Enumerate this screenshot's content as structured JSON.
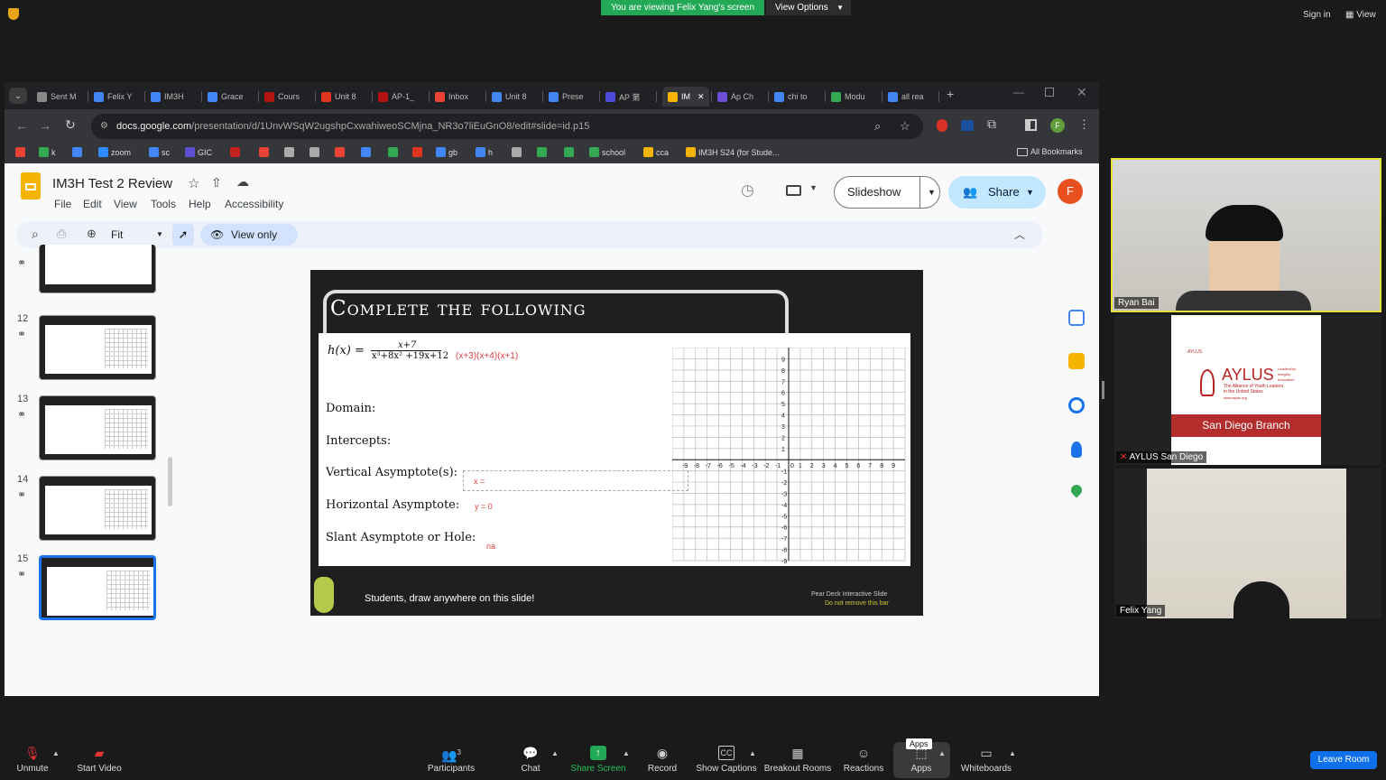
{
  "zoom": {
    "banner": "You are viewing Felix Yang's screen",
    "view_options": "View Options",
    "sign_in": "Sign in",
    "view": "View",
    "toolbar": {
      "unmute": "Unmute",
      "start_video": "Start Video",
      "participants": "Participants",
      "participants_count": "3",
      "chat": "Chat",
      "share_screen": "Share Screen",
      "record": "Record",
      "show_captions": "Show Captions",
      "breakout_rooms": "Breakout Rooms",
      "reactions": "Reactions",
      "apps": "Apps",
      "apps_tooltip": "Apps",
      "whiteboards": "Whiteboards",
      "leave": "Leave Room"
    },
    "participants": [
      {
        "name": "Ryan Bai"
      },
      {
        "name": "AYLUS San Diego"
      },
      {
        "name": "Felix Yang"
      }
    ],
    "aylus": {
      "small": "AYLUS",
      "big": "AYLUS",
      "tag1": "Leadership",
      "tag2": "Integrity",
      "tag3": "Innovation",
      "sub1": "The Alliance of Youth Leaders",
      "sub2": "in the United States",
      "url": "www.aylus.org",
      "branch": "San Diego Branch"
    }
  },
  "browser": {
    "tabs": [
      "Sent M",
      "Felix Y",
      "IM3H",
      "Grace",
      "Cours",
      "Unit 8",
      "AP-1_",
      "Inbox",
      "Unit 8",
      "Prese",
      "AP 第",
      "IM",
      "Ap Ch",
      "chi to",
      "Modu",
      "all rea"
    ],
    "tab_colors": [
      "#888",
      "#4285f4",
      "#4285f4",
      "#4285f4",
      "#b31412",
      "#e0341f",
      "#b31412",
      "#ea4335",
      "#4285f4",
      "#4285f4",
      "#4b4bd8",
      "#f4b400",
      "#6d4ed8",
      "#4285f4",
      "#34a853",
      "#4285f4"
    ],
    "url_host": "docs.google.com",
    "url_path": "/presentation/d/1UnvWSqW2ugshpCxwahiweoSCMjna_NR3o7liEuGnO8/edit#slide=id.p15",
    "profile_initial": "F",
    "bookmarks": [
      "",
      "k",
      "",
      "zoom",
      "sc",
      "GIC",
      "",
      "",
      "",
      "",
      "",
      "",
      "",
      "",
      "gb",
      "h",
      "",
      "",
      "",
      "school",
      "cca",
      "IM3H S24 (for Stude..."
    ],
    "all_bookmarks": "All Bookmarks"
  },
  "slides": {
    "title": "IM3H Test 2 Review",
    "menu": [
      "File",
      "Edit",
      "View",
      "Tools",
      "Help",
      "Accessibility"
    ],
    "zoom_label": "Fit",
    "view_only": "View only",
    "slideshow": "Slideshow",
    "share": "Share",
    "avatar": "F",
    "thumbs": [
      {
        "num": "12"
      },
      {
        "num": "13"
      },
      {
        "num": "14"
      },
      {
        "num": "15"
      }
    ],
    "slide": {
      "heading": "Complete the following",
      "func": "h(x) =",
      "numerator": "x+7",
      "denominator": "x³+8x² +19x+12",
      "factored": "(x+3)(x+4)(x+1)",
      "domain": "Domain:",
      "intercepts": "Intercepts:",
      "vertical": "Vertical Asymptote(s):",
      "vertical_ans": "x =",
      "horizontal": "Horizontal Asymptote:",
      "horizontal_ans": "y = 0",
      "slant": "Slant Asymptote or Hole:",
      "slant_ans": "na",
      "students": "Students, draw anywhere on this slide!",
      "peardeck1": "Pear Deck Interactive Slide",
      "peardeck2": "Do not remove this bar"
    }
  }
}
